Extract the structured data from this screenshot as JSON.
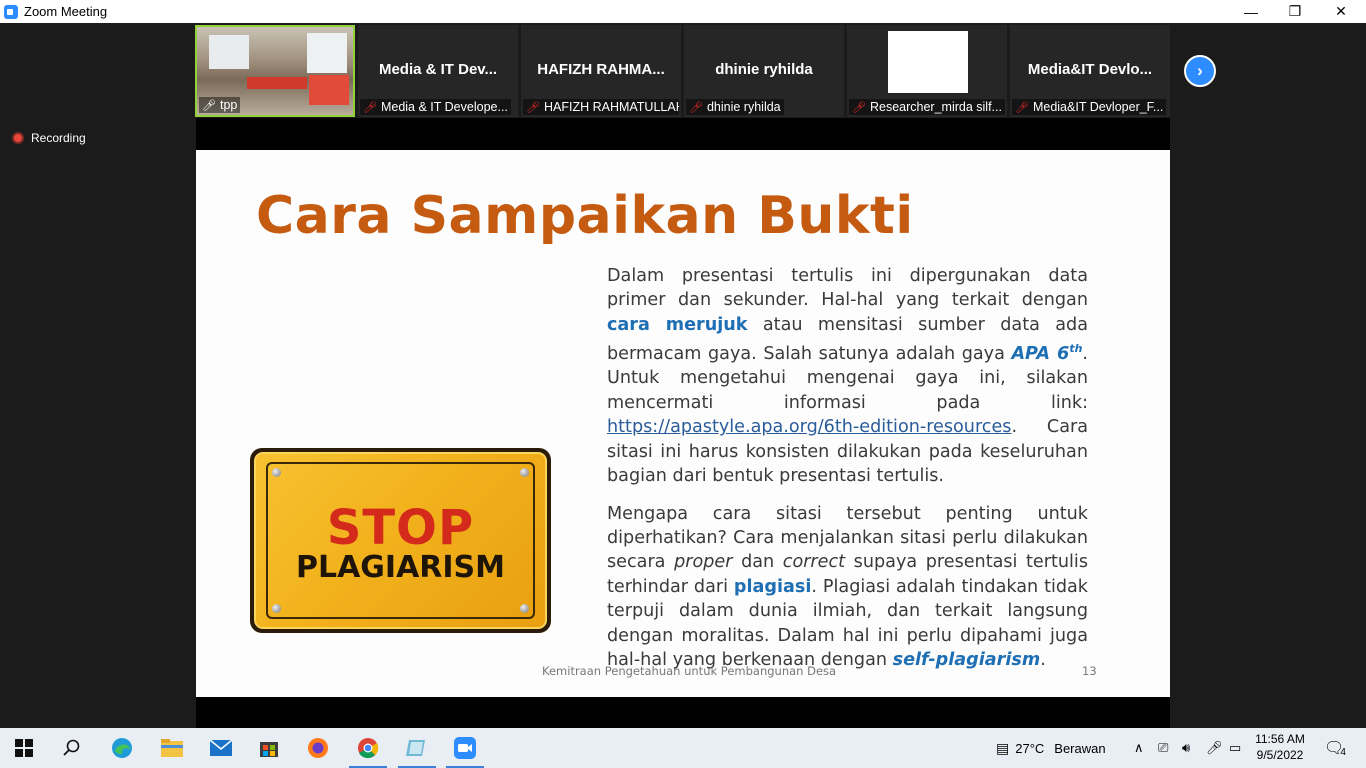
{
  "window": {
    "title": "Zoom Meeting",
    "minimize": "—",
    "restore": "❐",
    "close": "✕"
  },
  "participants": [
    {
      "display_name": "",
      "label": "tpp",
      "muted": false,
      "video": true
    },
    {
      "display_name": "Media & IT Dev...",
      "label": "Media & IT Develope...",
      "muted": true
    },
    {
      "display_name": "HAFIZH RAHMA...",
      "label": "HAFIZH RAHMATULLAH",
      "muted": true
    },
    {
      "display_name": "dhinie ryhilda",
      "label": "dhinie ryhilda",
      "muted": true
    },
    {
      "display_name": "",
      "label": "Researcher_mirda silf...",
      "muted": true,
      "white_box": true
    },
    {
      "display_name": "Media&IT Devlo...",
      "label": "Media&IT Devloper_F...",
      "muted": true
    }
  ],
  "recording": {
    "label": "Recording"
  },
  "slide": {
    "title": "Cara Sampaikan Bukti",
    "p1": {
      "t1": "Dalam presentasi tertulis ini dipergunakan data primer dan sekunder. Hal-hal yang terkait dengan ",
      "h1": "cara merujuk",
      "t2": " atau mensitasi sumber data ada bermacam gaya. Salah satunya adalah gaya ",
      "h2": "APA 6",
      "h2sup": "th",
      "t3": ". Untuk mengetahui mengenai gaya ini, silakan mencermati informasi pada link: ",
      "link": "https://apastyle.apa.org/6th-edition-resources",
      "t4": ". Cara sitasi ini harus konsisten dilakukan pada keseluruhan bagian dari bentuk presentasi tertulis."
    },
    "p2": {
      "t1": "Mengapa cara sitasi tersebut penting untuk diperhatikan? Cara menjalankan sitasi perlu dilakukan secara ",
      "i1": "proper",
      "t2": " dan ",
      "i2": "correct",
      "t3": " supaya presentasi tertulis terhindar dari ",
      "h1": "plagiasi",
      "t4": ". Plagiasi adalah tindakan tidak terpuji dalam dunia ilmiah, dan terkait langsung dengan moralitas. Dalam hal ini perlu dipahami juga hal-hal yang berkenaan dengan ",
      "h2": "self-plagiarism",
      "t5": "."
    },
    "sign_line1": "STOP",
    "sign_line2": "PLAGIARISM",
    "footer": "Kemitraan Pengetahuan untuk Pembangunan Desa",
    "page_number": "13"
  },
  "taskbar": {
    "weather": "27°C",
    "weather_desc": "Berawan",
    "time": "11:56 AM",
    "date": "9/5/2022",
    "notifications": "4"
  },
  "colors": {
    "accent": "#2d8cff",
    "slide_title": "#c55a11",
    "highlight": "#1f6fb5"
  }
}
